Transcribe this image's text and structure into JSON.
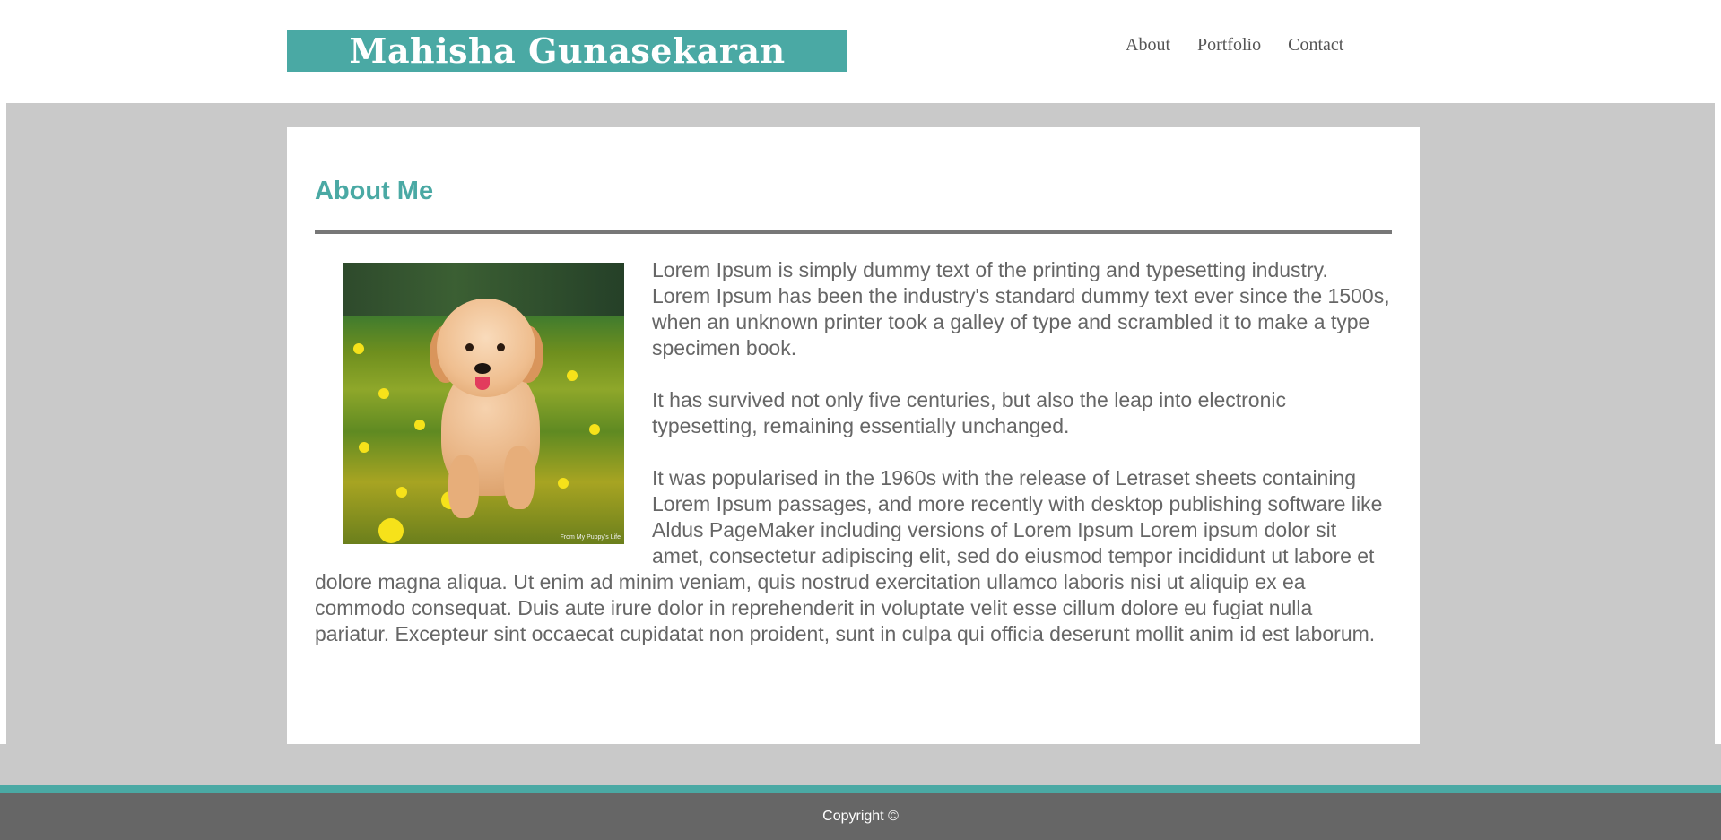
{
  "header": {
    "brand": "Mahisha Gunasekaran",
    "nav": [
      {
        "label": "About"
      },
      {
        "label": "Portfolio"
      },
      {
        "label": "Contact"
      }
    ]
  },
  "main": {
    "title": "About Me",
    "image": {
      "alt": "Golden retriever puppy running through a field of yellow flowers",
      "caption": "From My Puppy's Life"
    },
    "paragraphs": [
      "Lorem Ipsum is simply dummy text of the printing and typesetting industry. Lorem Ipsum has been the industry's standard dummy text ever since the 1500s, when an unknown printer took a galley of type and scrambled it to make a type specimen book.",
      "It has survived not only five centuries, but also the leap into electronic typesetting, remaining essentially unchanged.",
      "It was popularised in the 1960s with the release of Letraset sheets containing Lorem Ipsum passages, and more recently with desktop publishing software like Aldus PageMaker including versions of Lorem Ipsum Lorem ipsum dolor sit amet, consectetur adipiscing elit, sed do eiusmod tempor incididunt ut labore et dolore magna aliqua. Ut enim ad minim veniam, quis nostrud exercitation ullamco laboris nisi ut aliquip ex ea commodo consequat. Duis aute irure dolor in reprehenderit in voluptate velit esse cillum dolore eu fugiat nulla pariatur. Excepteur sint occaecat cupidatat non proident, sunt in culpa qui officia deserunt mollit anim id est laborum."
    ]
  },
  "footer": {
    "copyright": "Copyright ©"
  },
  "colors": {
    "accent": "#4aa9a4",
    "band": "#c9c9c9",
    "footer": "#666666",
    "text": "#666666"
  }
}
